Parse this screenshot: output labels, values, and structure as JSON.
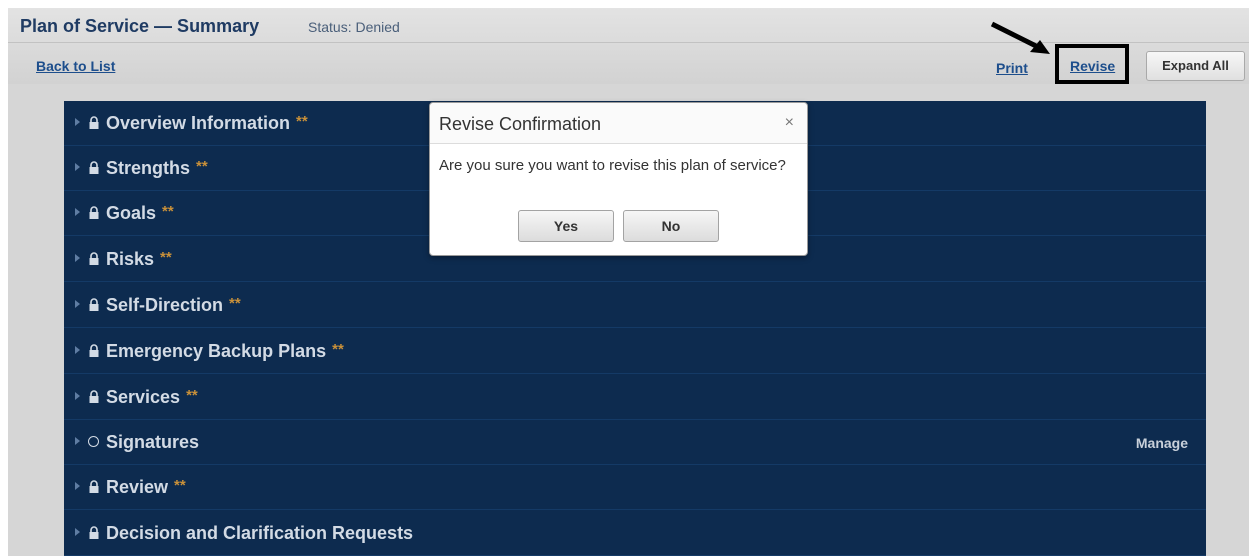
{
  "header": {
    "title": "Plan of Service — Summary",
    "status": "Status: Denied",
    "back_link": "Back to List",
    "print_link": "Print",
    "revise_link": "Revise",
    "expand_all": "Expand All"
  },
  "sections": [
    {
      "label": "Overview Information",
      "stars": "**",
      "icon": "lock-icon"
    },
    {
      "label": "Strengths",
      "stars": "**",
      "icon": "lock-icon"
    },
    {
      "label": "Goals",
      "stars": "**",
      "icon": "lock-icon"
    },
    {
      "label": "Risks",
      "stars": "**",
      "icon": "lock-icon"
    },
    {
      "label": "Self-Direction",
      "stars": "**",
      "icon": "lock-icon"
    },
    {
      "label": "Emergency Backup Plans",
      "stars": "**",
      "icon": "lock-icon"
    },
    {
      "label": "Services",
      "stars": "**",
      "icon": "lock-icon"
    },
    {
      "label": "Signatures",
      "stars": "",
      "icon": "circle-icon",
      "action": "Manage"
    },
    {
      "label": "Review",
      "stars": "**",
      "icon": "lock-icon"
    },
    {
      "label": "Decision and Clarification Requests",
      "stars": "",
      "icon": "lock-icon"
    }
  ],
  "modal": {
    "title": "Revise Confirmation",
    "close": "×",
    "message": "Are you sure you want to revise this plan of service?",
    "yes": "Yes",
    "no": "No"
  },
  "colors": {
    "panel": "#0d2b4f",
    "stars": "#c9913a",
    "link": "#1d4e8c"
  }
}
